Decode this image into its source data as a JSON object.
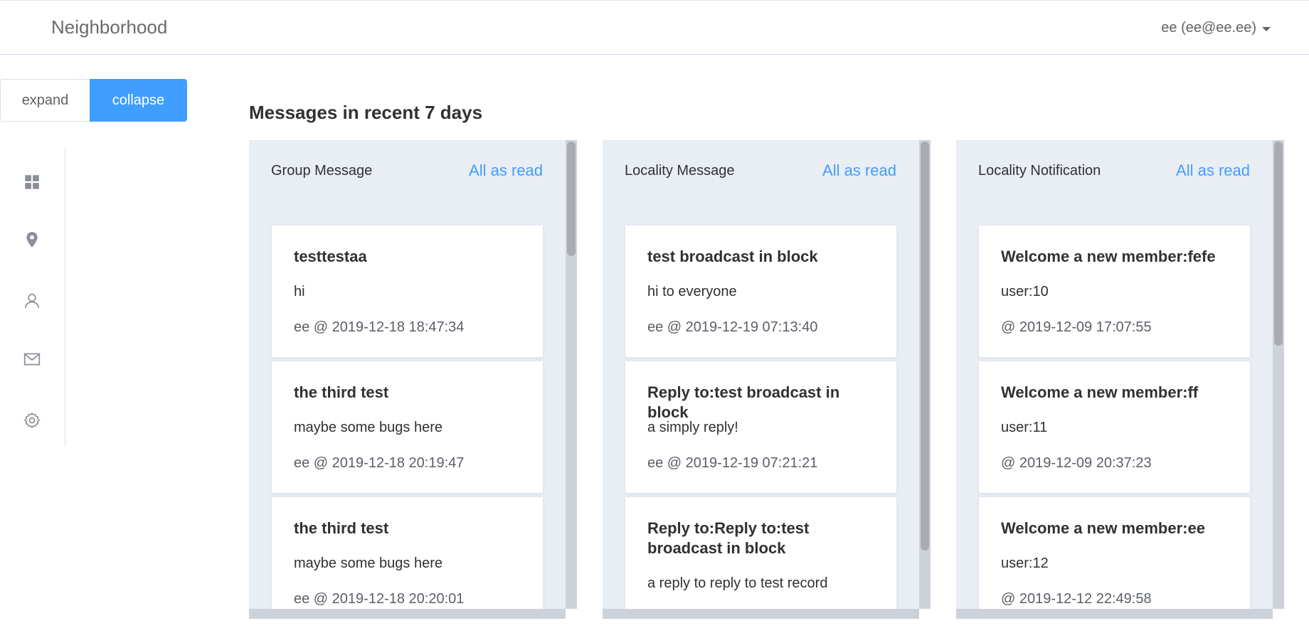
{
  "header": {
    "brand": "Neighborhood",
    "user": "ee (ee@ee.ee)"
  },
  "toggle": {
    "expand_label": "expand",
    "collapse_label": "collapse"
  },
  "sidenav": {
    "items": [
      {
        "icon": "dashboard-icon"
      },
      {
        "icon": "location-pin-icon"
      },
      {
        "icon": "user-icon"
      },
      {
        "icon": "mail-icon"
      },
      {
        "icon": "gear-icon"
      }
    ]
  },
  "main": {
    "title": "Messages in recent 7 days",
    "panels": [
      {
        "title": "Group Message",
        "action": "All as read",
        "cards": [
          {
            "title": "testtestaa",
            "body": "hi",
            "meta": "ee @ 2019-12-18 18:47:34"
          },
          {
            "title": "the third test",
            "body": "maybe some bugs here",
            "meta": "ee @ 2019-12-18 20:19:47"
          },
          {
            "title": "the third test",
            "body": "maybe some bugs here",
            "meta": "ee @ 2019-12-18 20:20:01"
          }
        ]
      },
      {
        "title": "Locality Message",
        "action": "All as read",
        "cards": [
          {
            "title": "test broadcast in block",
            "body": "hi to everyone",
            "meta": "ee @ 2019-12-19 07:13:40"
          },
          {
            "title": "Reply to:test broadcast in block",
            "body": "a simply reply!",
            "meta": "ee @ 2019-12-19 07:21:21"
          },
          {
            "title": "Reply to:Reply to:test broadcast in block",
            "body": "a reply to reply to test record",
            "meta": ""
          }
        ]
      },
      {
        "title": "Locality Notification",
        "action": "All as read",
        "cards": [
          {
            "title": "Welcome a new member:fefe",
            "body": "user:10",
            "meta": "@ 2019-12-09 17:07:55"
          },
          {
            "title": "Welcome a new member:ff",
            "body": "user:11",
            "meta": "@ 2019-12-09 20:37:23"
          },
          {
            "title": "Welcome a new member:ee",
            "body": "user:12",
            "meta": "@ 2019-12-12 22:49:58"
          }
        ]
      }
    ]
  },
  "colors": {
    "accent": "#409eff",
    "panel_bg": "#e9edf4"
  }
}
